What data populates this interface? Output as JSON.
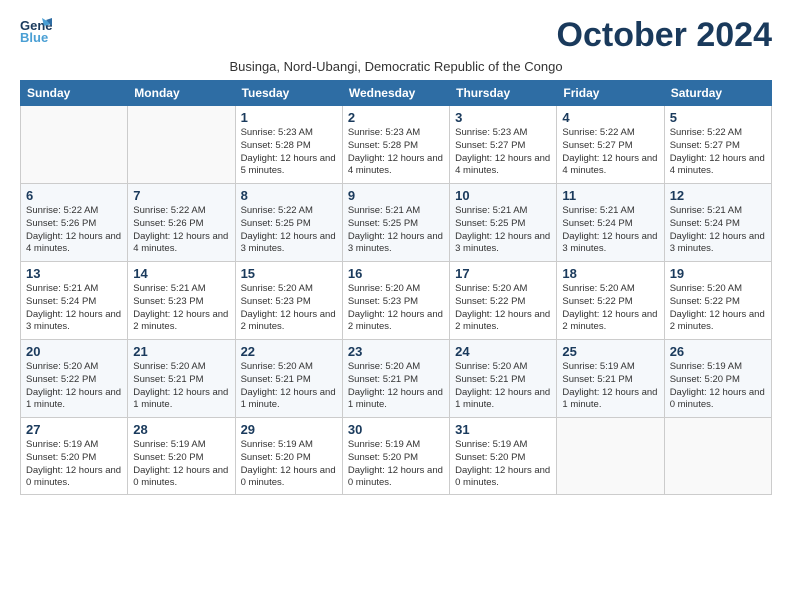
{
  "logo": {
    "line1": "General",
    "line2": "Blue"
  },
  "title": "October 2024",
  "subtitle": "Businga, Nord-Ubangi, Democratic Republic of the Congo",
  "days_of_week": [
    "Sunday",
    "Monday",
    "Tuesday",
    "Wednesday",
    "Thursday",
    "Friday",
    "Saturday"
  ],
  "weeks": [
    [
      {
        "day": "",
        "info": ""
      },
      {
        "day": "",
        "info": ""
      },
      {
        "day": "1",
        "info": "Sunrise: 5:23 AM\nSunset: 5:28 PM\nDaylight: 12 hours\nand 5 minutes."
      },
      {
        "day": "2",
        "info": "Sunrise: 5:23 AM\nSunset: 5:28 PM\nDaylight: 12 hours\nand 4 minutes."
      },
      {
        "day": "3",
        "info": "Sunrise: 5:23 AM\nSunset: 5:27 PM\nDaylight: 12 hours\nand 4 minutes."
      },
      {
        "day": "4",
        "info": "Sunrise: 5:22 AM\nSunset: 5:27 PM\nDaylight: 12 hours\nand 4 minutes."
      },
      {
        "day": "5",
        "info": "Sunrise: 5:22 AM\nSunset: 5:27 PM\nDaylight: 12 hours\nand 4 minutes."
      }
    ],
    [
      {
        "day": "6",
        "info": "Sunrise: 5:22 AM\nSunset: 5:26 PM\nDaylight: 12 hours\nand 4 minutes."
      },
      {
        "day": "7",
        "info": "Sunrise: 5:22 AM\nSunset: 5:26 PM\nDaylight: 12 hours\nand 4 minutes."
      },
      {
        "day": "8",
        "info": "Sunrise: 5:22 AM\nSunset: 5:25 PM\nDaylight: 12 hours\nand 3 minutes."
      },
      {
        "day": "9",
        "info": "Sunrise: 5:21 AM\nSunset: 5:25 PM\nDaylight: 12 hours\nand 3 minutes."
      },
      {
        "day": "10",
        "info": "Sunrise: 5:21 AM\nSunset: 5:25 PM\nDaylight: 12 hours\nand 3 minutes."
      },
      {
        "day": "11",
        "info": "Sunrise: 5:21 AM\nSunset: 5:24 PM\nDaylight: 12 hours\nand 3 minutes."
      },
      {
        "day": "12",
        "info": "Sunrise: 5:21 AM\nSunset: 5:24 PM\nDaylight: 12 hours\nand 3 minutes."
      }
    ],
    [
      {
        "day": "13",
        "info": "Sunrise: 5:21 AM\nSunset: 5:24 PM\nDaylight: 12 hours\nand 3 minutes."
      },
      {
        "day": "14",
        "info": "Sunrise: 5:21 AM\nSunset: 5:23 PM\nDaylight: 12 hours\nand 2 minutes."
      },
      {
        "day": "15",
        "info": "Sunrise: 5:20 AM\nSunset: 5:23 PM\nDaylight: 12 hours\nand 2 minutes."
      },
      {
        "day": "16",
        "info": "Sunrise: 5:20 AM\nSunset: 5:23 PM\nDaylight: 12 hours\nand 2 minutes."
      },
      {
        "day": "17",
        "info": "Sunrise: 5:20 AM\nSunset: 5:22 PM\nDaylight: 12 hours\nand 2 minutes."
      },
      {
        "day": "18",
        "info": "Sunrise: 5:20 AM\nSunset: 5:22 PM\nDaylight: 12 hours\nand 2 minutes."
      },
      {
        "day": "19",
        "info": "Sunrise: 5:20 AM\nSunset: 5:22 PM\nDaylight: 12 hours\nand 2 minutes."
      }
    ],
    [
      {
        "day": "20",
        "info": "Sunrise: 5:20 AM\nSunset: 5:22 PM\nDaylight: 12 hours\nand 1 minute."
      },
      {
        "day": "21",
        "info": "Sunrise: 5:20 AM\nSunset: 5:21 PM\nDaylight: 12 hours\nand 1 minute."
      },
      {
        "day": "22",
        "info": "Sunrise: 5:20 AM\nSunset: 5:21 PM\nDaylight: 12 hours\nand 1 minute."
      },
      {
        "day": "23",
        "info": "Sunrise: 5:20 AM\nSunset: 5:21 PM\nDaylight: 12 hours\nand 1 minute."
      },
      {
        "day": "24",
        "info": "Sunrise: 5:20 AM\nSunset: 5:21 PM\nDaylight: 12 hours\nand 1 minute."
      },
      {
        "day": "25",
        "info": "Sunrise: 5:19 AM\nSunset: 5:21 PM\nDaylight: 12 hours\nand 1 minute."
      },
      {
        "day": "26",
        "info": "Sunrise: 5:19 AM\nSunset: 5:20 PM\nDaylight: 12 hours\nand 0 minutes."
      }
    ],
    [
      {
        "day": "27",
        "info": "Sunrise: 5:19 AM\nSunset: 5:20 PM\nDaylight: 12 hours\nand 0 minutes."
      },
      {
        "day": "28",
        "info": "Sunrise: 5:19 AM\nSunset: 5:20 PM\nDaylight: 12 hours\nand 0 minutes."
      },
      {
        "day": "29",
        "info": "Sunrise: 5:19 AM\nSunset: 5:20 PM\nDaylight: 12 hours\nand 0 minutes."
      },
      {
        "day": "30",
        "info": "Sunrise: 5:19 AM\nSunset: 5:20 PM\nDaylight: 12 hours\nand 0 minutes."
      },
      {
        "day": "31",
        "info": "Sunrise: 5:19 AM\nSunset: 5:20 PM\nDaylight: 12 hours\nand 0 minutes."
      },
      {
        "day": "",
        "info": ""
      },
      {
        "day": "",
        "info": ""
      }
    ]
  ]
}
